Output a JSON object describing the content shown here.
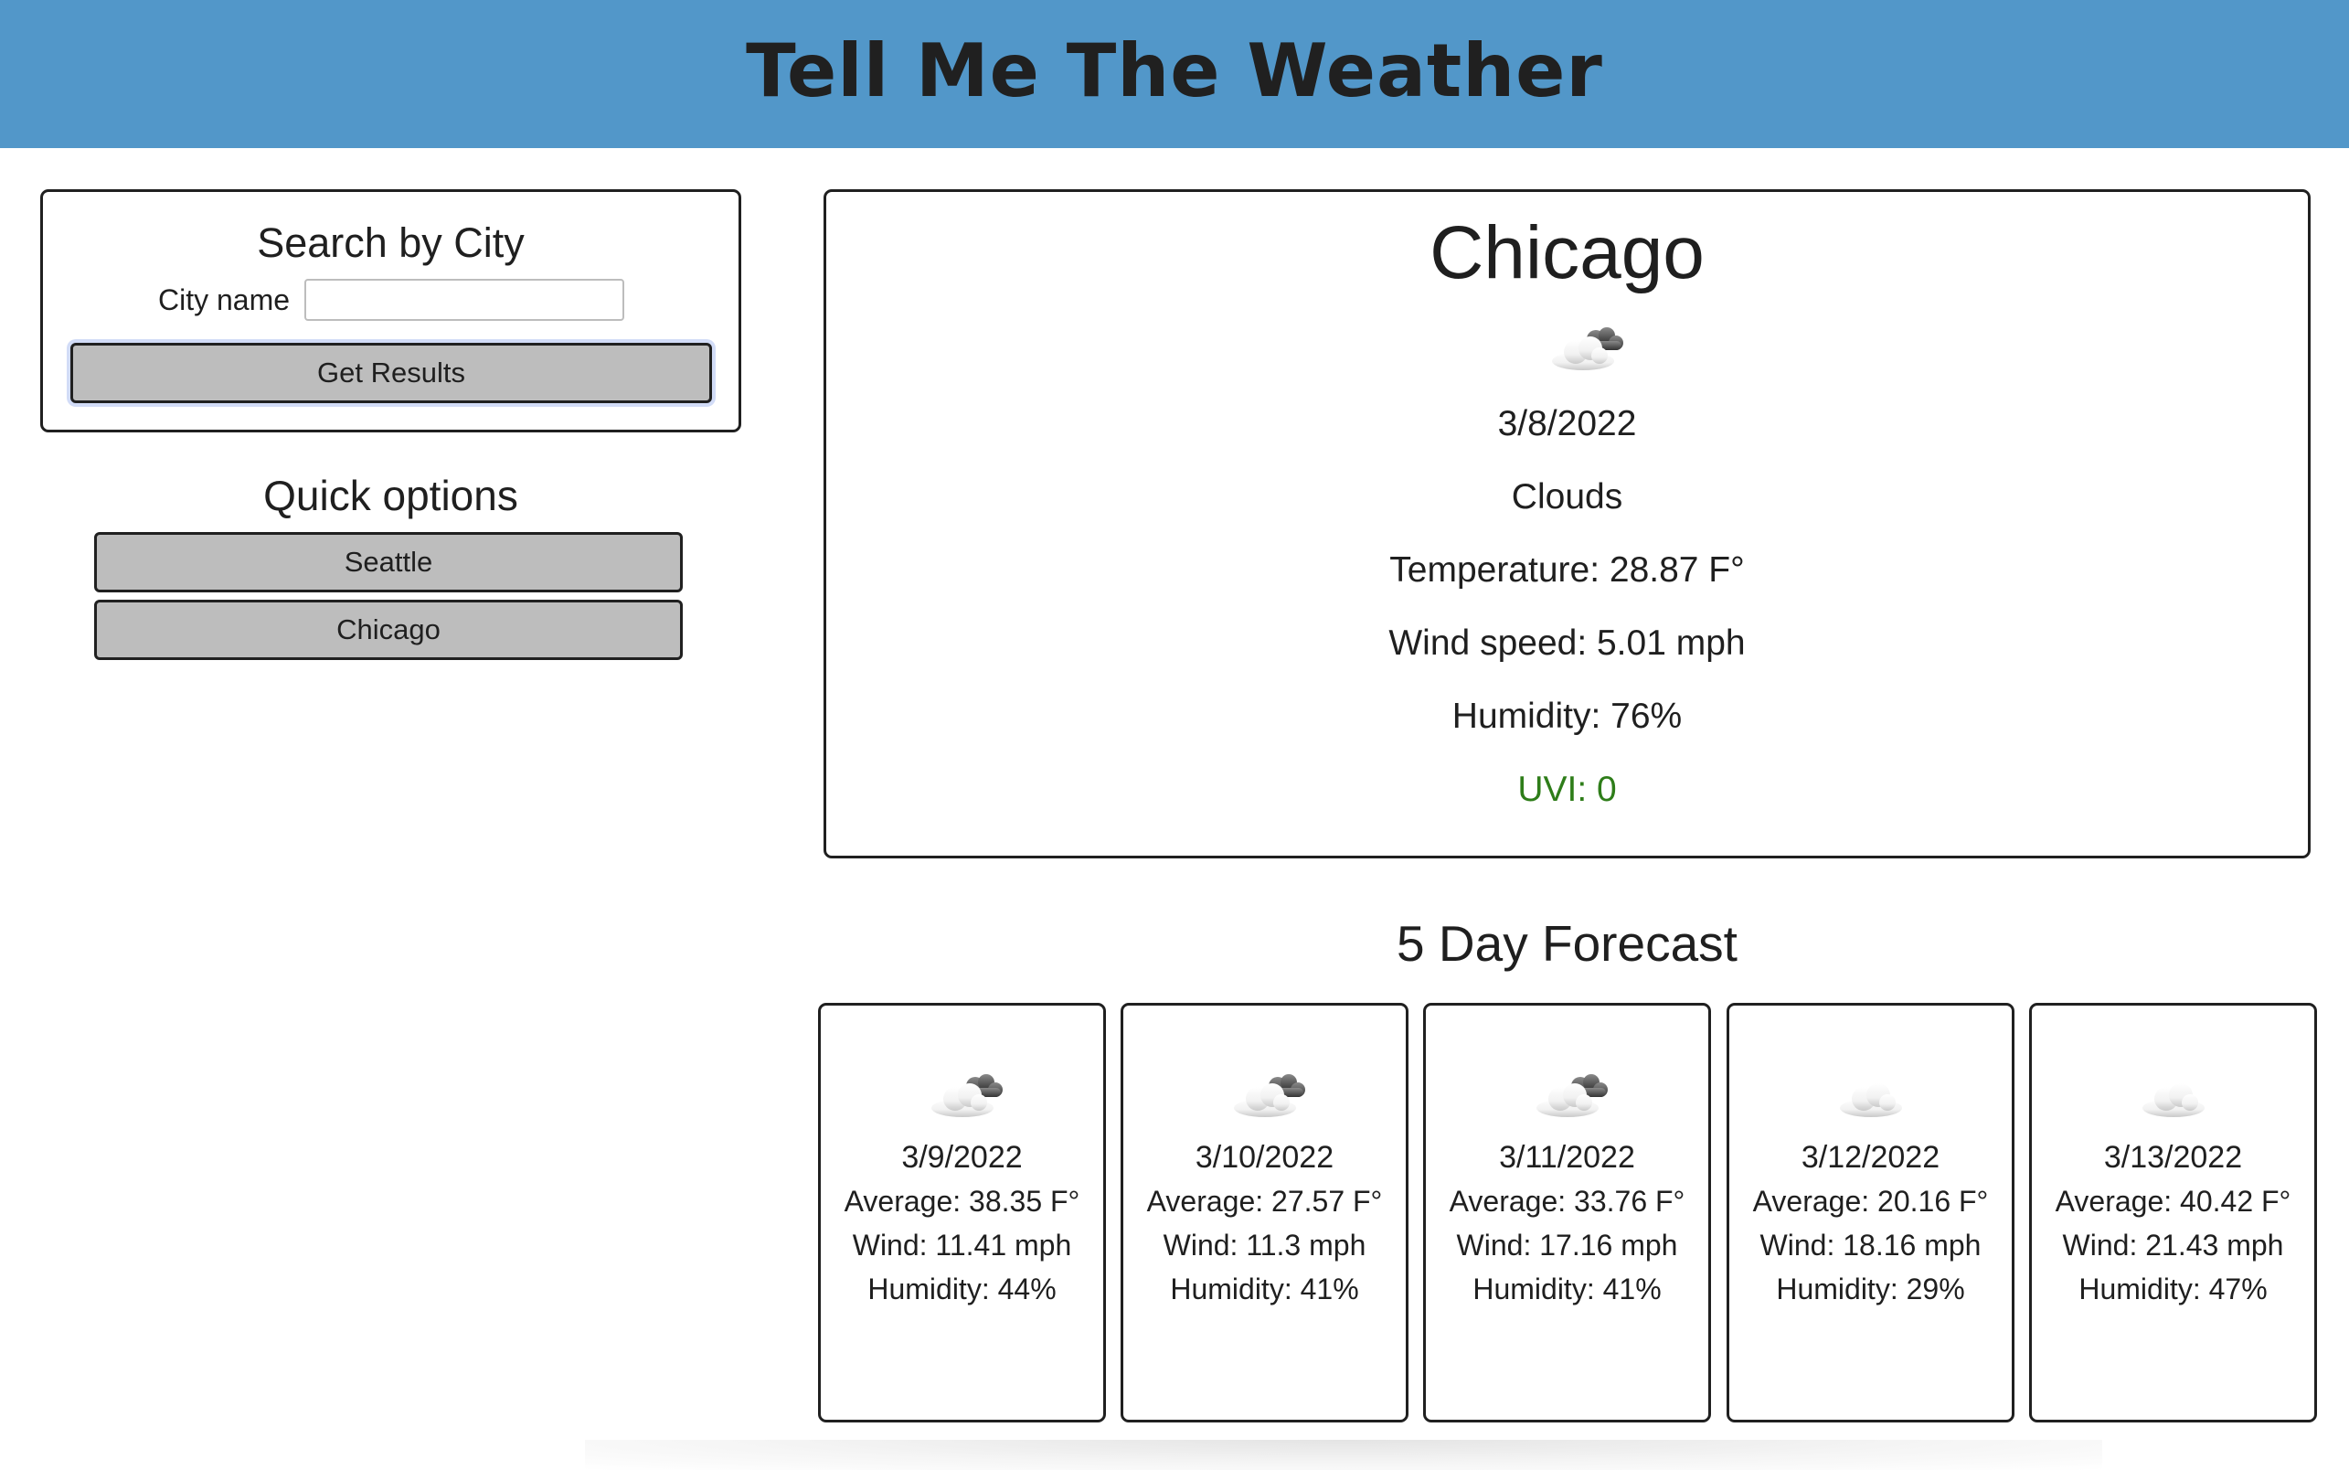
{
  "header": {
    "title": "Tell Me The Weather"
  },
  "search": {
    "title": "Search by City",
    "city_label": "City name",
    "input_value": "",
    "input_placeholder": "",
    "button_label": "Get Results"
  },
  "quick_options": {
    "title": "Quick options",
    "items": [
      {
        "label": "Seattle"
      },
      {
        "label": "Chicago"
      }
    ]
  },
  "current": {
    "city": "Chicago",
    "icon": "scattered-clouds-icon",
    "date": "3/8/2022",
    "condition": "Clouds",
    "temperature": "Temperature: 28.87 F°",
    "wind": "Wind speed: 5.01 mph",
    "humidity": "Humidity: 76%",
    "uvi": "UVI: 0",
    "uvi_color": "#2e7d19"
  },
  "forecast": {
    "title": "5 Day Forecast",
    "days": [
      {
        "icon": "scattered-clouds-icon",
        "date": "3/9/2022",
        "average": "Average: 38.35 F°",
        "wind": "Wind: 11.41 mph",
        "humidity": "Humidity: 44%"
      },
      {
        "icon": "scattered-clouds-icon",
        "date": "3/10/2022",
        "average": "Average: 27.57 F°",
        "wind": "Wind: 11.3 mph",
        "humidity": "Humidity: 41%"
      },
      {
        "icon": "scattered-clouds-icon",
        "date": "3/11/2022",
        "average": "Average: 33.76 F°",
        "wind": "Wind: 17.16 mph",
        "humidity": "Humidity: 41%"
      },
      {
        "icon": "cloud-icon",
        "date": "3/12/2022",
        "average": "Average: 20.16 F°",
        "wind": "Wind: 18.16 mph",
        "humidity": "Humidity: 29%"
      },
      {
        "icon": "cloud-icon",
        "date": "3/13/2022",
        "average": "Average: 40.42 F°",
        "wind": "Wind: 21.43 mph",
        "humidity": "Humidity: 47%"
      }
    ]
  },
  "colors": {
    "header_bg": "#5297c9",
    "button_bg": "#bdbdbd"
  }
}
